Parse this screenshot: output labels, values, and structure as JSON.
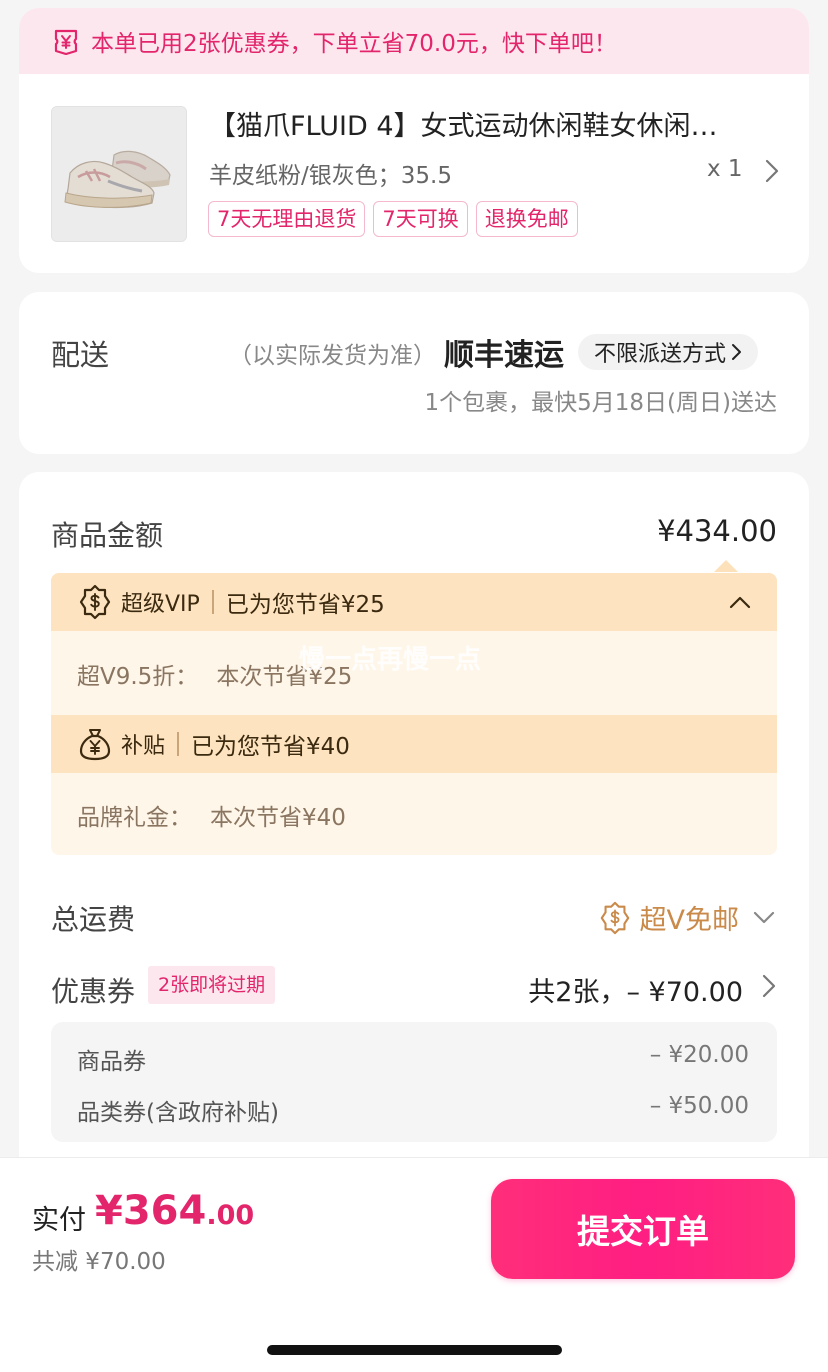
{
  "colors": {
    "accent": "#e3256b",
    "submit_button": "#ff1e82",
    "vip_gold": "#c98a4a",
    "discount_header_bg": "#fde3bf",
    "discount_body_bg": "#fff6ea"
  },
  "coupon_banner": {
    "icon": "coupon-yen-icon",
    "text": "本单已用2张优惠券，下单立省70.0元，快下单吧！"
  },
  "product": {
    "image": "sneaker-thumbnail",
    "title": "【猫爪FLUID 4】女式运动休闲鞋女休闲…",
    "variant": "羊皮纸粉/银灰色；35.5",
    "quantity": "x 1",
    "tags": [
      "7天无理由退货",
      "7天可换",
      "退换免邮"
    ]
  },
  "delivery": {
    "label": "配送",
    "note": "（以实际发货为准）",
    "carrier": "顺丰速运",
    "method_button": "不限派送方式",
    "eta": "1个包裹，最快5月18日(周日)送达"
  },
  "pricing": {
    "goods_label": "商品金额",
    "goods_amount": "¥434.00",
    "watermark": "慢一点再慢一点",
    "vip": {
      "icon": "vip-badge-icon",
      "name": "超级VIP",
      "saved": "已为您节省¥25",
      "detail_label": "超V9.5折：",
      "detail_value": "本次节省¥25"
    },
    "subsidy": {
      "icon": "money-bag-icon",
      "name": "补贴",
      "saved": "已为您节省¥40",
      "detail_label": "品牌礼金：",
      "detail_value": "本次节省¥40"
    },
    "shipping_label": "总运费",
    "shipping_value": "超V免邮",
    "coupon_label": "优惠券",
    "coupon_badge": "2张即将过期",
    "coupon_summary": "共2张，– ¥70.00",
    "coupons": [
      {
        "name": "商品券",
        "value": "– ¥20.00"
      },
      {
        "name": "品类券(含政府补贴)",
        "value": "– ¥50.00"
      }
    ]
  },
  "checkout": {
    "pay_label": "实付",
    "pay_amount_int": "¥364",
    "pay_amount_dec": ".00",
    "total_saved": "共减 ¥70.00",
    "submit_label": "提交订单"
  }
}
